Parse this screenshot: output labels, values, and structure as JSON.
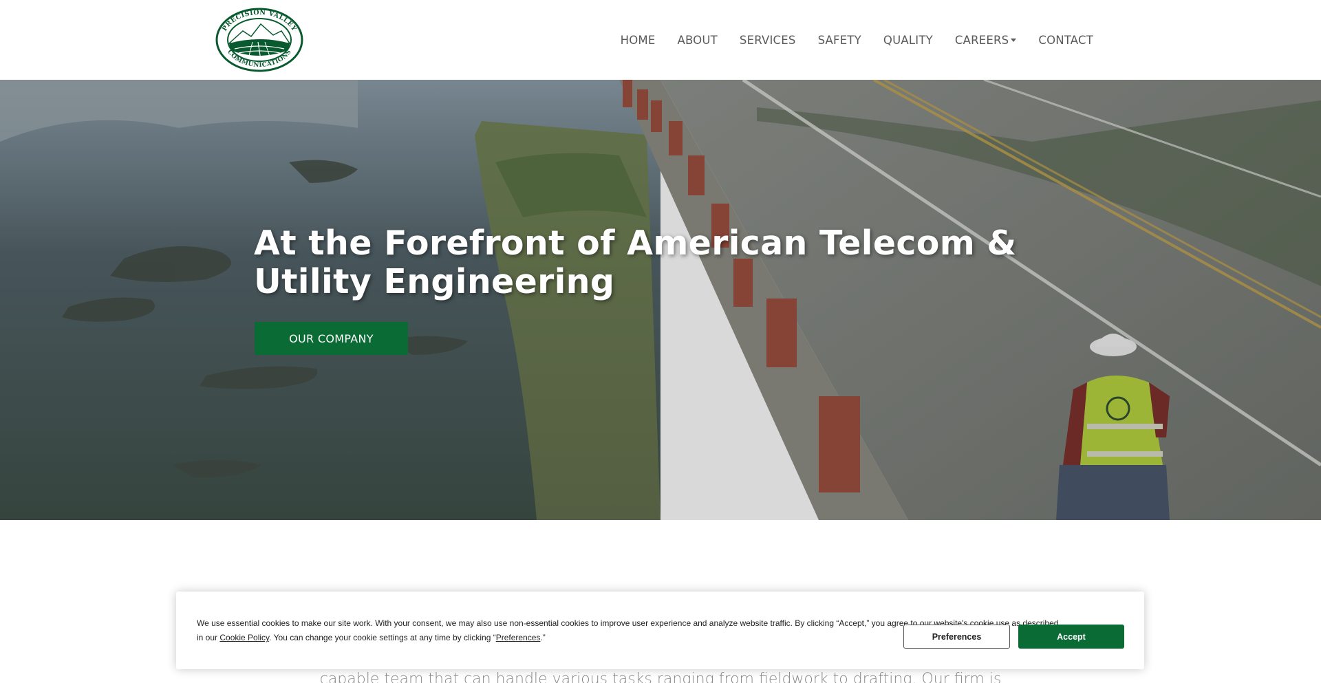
{
  "header": {
    "logo": {
      "name": "precision-valley-logo",
      "text_top": "PRECISION VALLEY",
      "text_bottom": "COMMUNICATIONS",
      "color": "#0a5a30"
    },
    "nav": [
      {
        "label": "HOME"
      },
      {
        "label": "ABOUT"
      },
      {
        "label": "SERVICES"
      },
      {
        "label": "SAFETY"
      },
      {
        "label": "QUALITY"
      },
      {
        "label": "CAREERS",
        "has_dropdown": true
      },
      {
        "label": "CONTACT"
      }
    ]
  },
  "hero": {
    "title": "At the Forefront of American Telecom & Utility Engineering",
    "button_label": "OUR COMPANY",
    "accent_color": "#0a6b34"
  },
  "section": {
    "partial_text": "capable team that can handle various tasks ranging from fieldwork to drafting. Our firm is"
  },
  "cookie_banner": {
    "text_part1": "We use essential cookies to make our site work. With your consent, we may also use non-essential cookies to improve user experience and analyze website traffic. By clicking “Accept,” you agree to our website's cookie use as described in our ",
    "cookie_policy_link": "Cookie Policy",
    "text_part2": ". You can change your cookie settings at any time by clicking “",
    "preferences_link": "Preferences",
    "text_part3": ".”",
    "preferences_button": "Preferences",
    "accept_button": "Accept"
  }
}
